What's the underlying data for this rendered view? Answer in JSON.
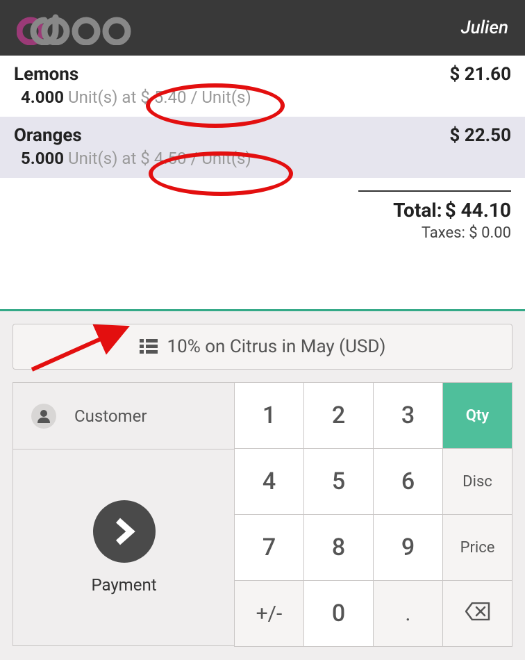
{
  "header": {
    "user": "Julien"
  },
  "order": {
    "lines": [
      {
        "name": "Lemons",
        "qty": "4.000",
        "uom": "Unit(s)",
        "price": "$ 5.40",
        "per": "Unit(s)",
        "total": "$ 21.60"
      },
      {
        "name": "Oranges",
        "qty": "5.000",
        "uom": "Unit(s)",
        "price": "$ 4.50",
        "per": "Unit(s)",
        "total": "$ 22.50"
      }
    ],
    "total_label": "Total:",
    "total_amount": "$ 44.10",
    "taxes_label": "Taxes:",
    "taxes_amount": "$ 0.00"
  },
  "pricelist": {
    "label": "10% on Citrus in May (USD)"
  },
  "actions": {
    "customer": "Customer",
    "payment": "Payment"
  },
  "numpad": {
    "k1": "1",
    "k2": "2",
    "k3": "3",
    "k4": "4",
    "k5": "5",
    "k6": "6",
    "k7": "7",
    "k8": "8",
    "k9": "9",
    "sign": "+/-",
    "k0": "0",
    "dot": ".",
    "qty": "Qty",
    "disc": "Disc",
    "price": "Price"
  },
  "sub_at": "at",
  "sub_slash": "/"
}
